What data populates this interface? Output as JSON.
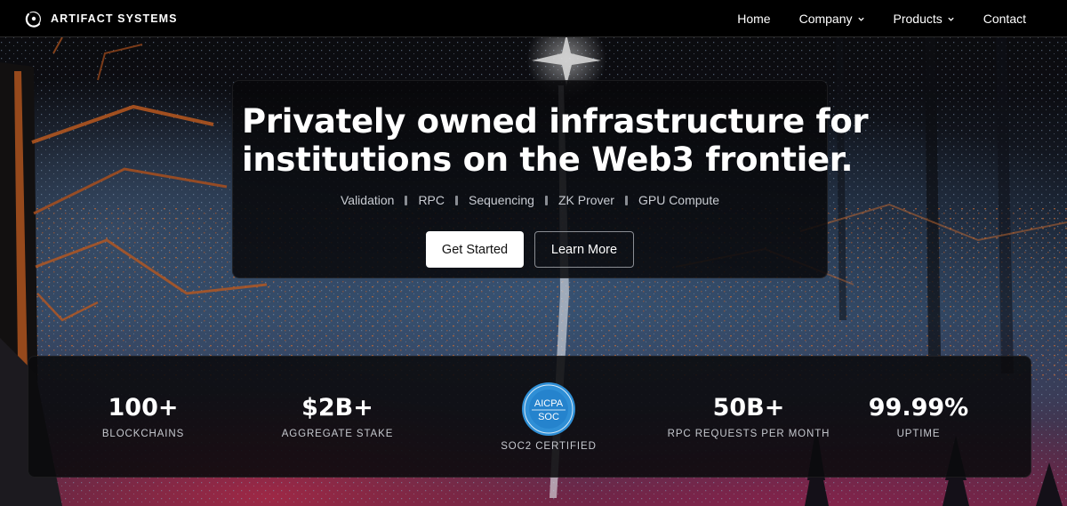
{
  "brand": {
    "name": "ARTIFACT SYSTEMS"
  },
  "nav": {
    "items": [
      {
        "label": "Home",
        "has_dropdown": false
      },
      {
        "label": "Company",
        "has_dropdown": true
      },
      {
        "label": "Products",
        "has_dropdown": true
      },
      {
        "label": "Contact",
        "has_dropdown": false
      }
    ]
  },
  "hero": {
    "title_line1": "Privately owned infrastructure for",
    "title_line2": "institutions on the Web3 frontier.",
    "services": [
      "Validation",
      "RPC",
      "Sequencing",
      "ZK Prover",
      "GPU Compute"
    ],
    "primary_cta": "Get Started",
    "secondary_cta": "Learn More"
  },
  "stats": [
    {
      "value": "100+",
      "label": "BLOCKCHAINS"
    },
    {
      "value": "$2B+",
      "label": "AGGREGATE STAKE"
    },
    {
      "badge_top": "AICPA",
      "badge_bottom": "SOC",
      "label": "SOC2 CERTIFIED"
    },
    {
      "value": "50B+",
      "label": "RPC REQUESTS PER MONTH"
    },
    {
      "value": "99.99%",
      "label": "UPTIME"
    }
  ],
  "colors": {
    "nav_bg": "#000000",
    "primary_button_bg": "#ffffff",
    "badge_blue": "#2f8fd6",
    "sky_orange": "#c8692e",
    "ground_magenta": "#8a2a4a"
  },
  "icons": {
    "logo": "artifact-ring-logo-icon",
    "dropdown": "chevron-down-icon",
    "badge": "aicpa-soc-badge-icon"
  }
}
